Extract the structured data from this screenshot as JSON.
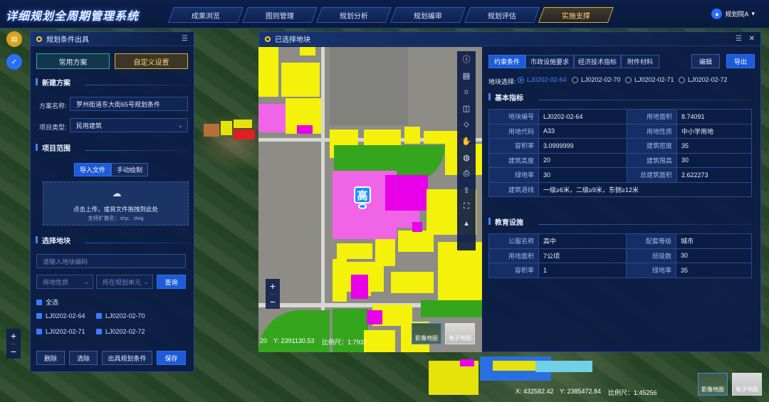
{
  "app": {
    "title": "详细规划全周期管理系统"
  },
  "nav": [
    {
      "label": "成果浏览"
    },
    {
      "label": "图则管理"
    },
    {
      "label": "规划分析"
    },
    {
      "label": "规划编审"
    },
    {
      "label": "规划评估"
    },
    {
      "label": "实施支撑",
      "active": true
    }
  ],
  "user": {
    "name": "规划院A",
    "avatar": "user-icon"
  },
  "left_panel": {
    "title": "规划条件出具",
    "tabs": [
      {
        "label": "常用方案"
      },
      {
        "label": "自定义设置"
      }
    ],
    "new_plan": {
      "section": "新建方案",
      "name_label": "方案名称:",
      "name_value": "罗州街道东大街65号规划条件",
      "type_label": "项目类型:",
      "type_value": "民用建筑"
    },
    "scope": {
      "section": "项目范围",
      "import_label": "导入文件",
      "draw_label": "手动绘制",
      "upload_text": "点击上传，或将文件拖拽到此处",
      "upload_hint": "支持扩展名：shp、dwg"
    },
    "select": {
      "section": "选择地块",
      "search_placeholder": "请输入地块编码",
      "filter1_placeholder": "用地性质",
      "filter2_placeholder": "所在规划单元",
      "query_label": "查询",
      "select_all": "全选",
      "items": [
        "LJ0202-02-64",
        "LJ0202-02-70",
        "LJ0202-02-71",
        "LJ0202-02-72"
      ]
    },
    "footer": {
      "delete": "删除",
      "clear": "清除",
      "issue": "出具规划条件",
      "save": "保存"
    }
  },
  "dialog": {
    "title": "已选择地块",
    "tabs": [
      {
        "label": "约束条件",
        "active": true
      },
      {
        "label": "市政设施要求"
      },
      {
        "label": "经济技术指标"
      },
      {
        "label": "附件材料"
      }
    ],
    "edit_label": "编辑",
    "export_label": "导出",
    "parcel_select_label": "地块选择:",
    "parcels": [
      "LJ0202-02-64",
      "LJ0202-02-70",
      "LJ0202-02-71",
      "LJ0202-02-72"
    ],
    "basic": {
      "section": "基本指标",
      "rows": [
        {
          "k1": "地块编号",
          "v1": "LJ0202-02-64",
          "k2": "用地面积",
          "v2": "8.74091"
        },
        {
          "k1": "用地代码",
          "v1": "A33",
          "k2": "用地性质",
          "v2": "中小学用地"
        },
        {
          "k1": "容积率",
          "v1": "3.0999999",
          "k2": "建筑密度",
          "v2": "35"
        },
        {
          "k1": "建筑高度",
          "v1": "20",
          "k2": "建筑限高",
          "v2": "30"
        },
        {
          "k1": "绿地率",
          "v1": "30",
          "k2": "总建筑面积",
          "v2": "2.622273"
        }
      ],
      "setback_label": "建筑退线",
      "setback_value": "一级≥6米，二级≥9米，东侧≥12米"
    },
    "education": {
      "section": "教育设施",
      "rows": [
        {
          "k1": "公服名称",
          "v1": "高中",
          "k2": "配套等级",
          "v2": "城市"
        },
        {
          "k1": "用地面积",
          "v1": "7公顷",
          "k2": "班级数",
          "v2": "30"
        },
        {
          "k1": "容积率",
          "v1": "1",
          "k2": "绿地率",
          "v2": "35"
        }
      ]
    },
    "map": {
      "marker": "高",
      "coord_x_fragment": "20",
      "coord_y": "Y:  2391130.53",
      "scale": "比例尺：1:7937",
      "basemap_image": "影像地图",
      "basemap_vector": "电子地图"
    }
  },
  "main_map": {
    "coord_x": "X:  432582.42",
    "coord_y": "Y:  2385472.84",
    "scale": "比例尺：1:45256",
    "basemap_image": "影像地图",
    "basemap_vector": "电子地图"
  }
}
